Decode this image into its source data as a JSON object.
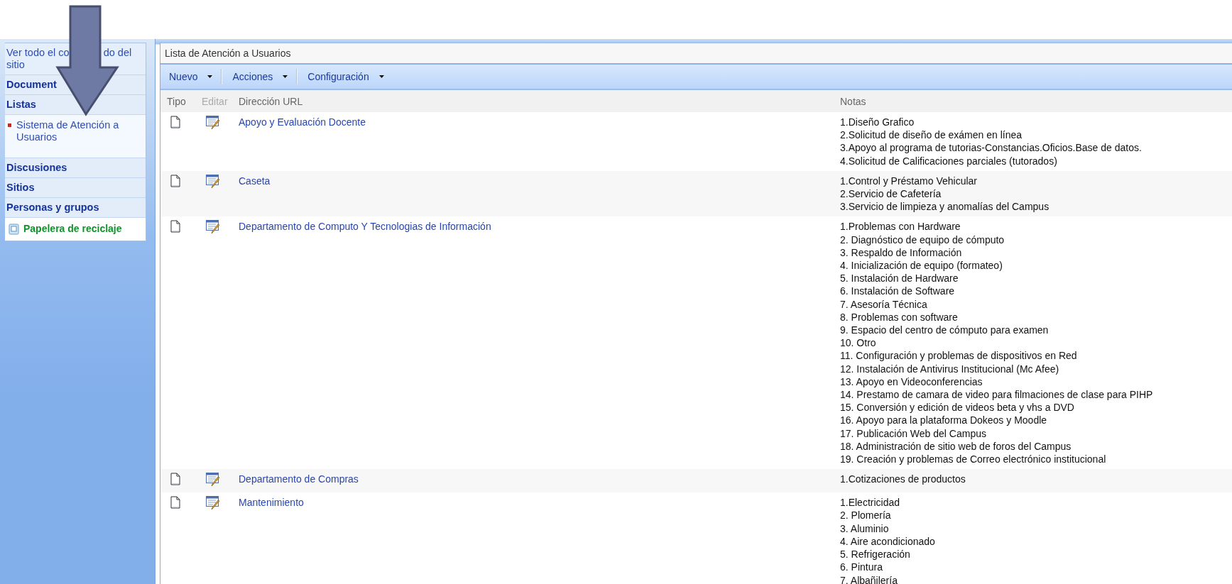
{
  "sidebar": {
    "items": [
      {
        "kind": "link",
        "segments": [
          "Ver todo el co",
          "do del",
          "sitio"
        ]
      },
      {
        "kind": "header",
        "label": "Document"
      },
      {
        "kind": "header",
        "label": "Listas"
      },
      {
        "kind": "subitem",
        "label": "Sistema de Atención a Usuarios"
      },
      {
        "kind": "header",
        "label": "Discusiones"
      },
      {
        "kind": "header",
        "label": "Sitios"
      },
      {
        "kind": "header",
        "label": "Personas y grupos"
      },
      {
        "kind": "recycle",
        "label": "Papelera de reciclaje"
      }
    ]
  },
  "list": {
    "title": "Lista de Atención a Usuarios",
    "toolbar": [
      "Nuevo",
      "Acciones",
      "Configuración"
    ],
    "columns": [
      {
        "label": "Tipo",
        "disabled": false
      },
      {
        "label": "Editar",
        "disabled": true
      },
      {
        "label": "Dirección URL",
        "disabled": false
      },
      {
        "label": "Notas",
        "disabled": false
      }
    ],
    "rows": [
      {
        "url": "Apoyo y Evaluación Docente",
        "notes": [
          "1.Diseño Grafico",
          "2.Solicitud de diseño de exámen en línea",
          "3.Apoyo al programa de tutorias-Constancias.Oficios.Base de datos.",
          "4.Solicitud de Calificaciones parciales (tutorados)"
        ]
      },
      {
        "url": "Caseta",
        "notes": [
          "1.Control y Préstamo Vehicular",
          "2.Servicio de Cafetería",
          "3.Servicio de limpieza y anomalías del Campus"
        ]
      },
      {
        "url": "Departamento de Computo Y Tecnologias de Información",
        "notes": [
          "1.Problemas con Hardware",
          "2. Diagnóstico de equipo de cómputo",
          "3. Respaldo de Información",
          "4. Inicialización de equipo (formateo)",
          "5. Instalación de Hardware",
          "6. Instalación de Software",
          "7. Asesoría Técnica",
          "8. Problemas con software",
          "9. Espacio del centro de cómputo para examen",
          "10. Otro",
          "11. Configuración y problemas de dispositivos en Red",
          "12. Instalación de Antivirus Institucional (Mc Afee)",
          "13. Apoyo en Videoconferencias",
          "14. Prestamo de camara de video para filmaciones de clase  para PIHP",
          "15. Conversión y edición de videos beta y vhs a DVD",
          "16. Apoyo para la plataforma Dokeos y Moodle",
          "17. Publicación Web del Campus",
          "18. Administración de sitio web de foros del Campus",
          "19. Creación y problemas de Correo electrónico institucional"
        ]
      },
      {
        "url": "Departamento de Compras",
        "notes": [
          "1.Cotizaciones de productos"
        ]
      },
      {
        "url": "Mantenimiento",
        "notes": [
          "1.Electricidad",
          "2. Plomería",
          "3. Aluminio",
          "4. Aire acondicionado",
          "5. Refrigeración",
          "6. Pintura",
          "7. Albañilería"
        ]
      }
    ]
  }
}
